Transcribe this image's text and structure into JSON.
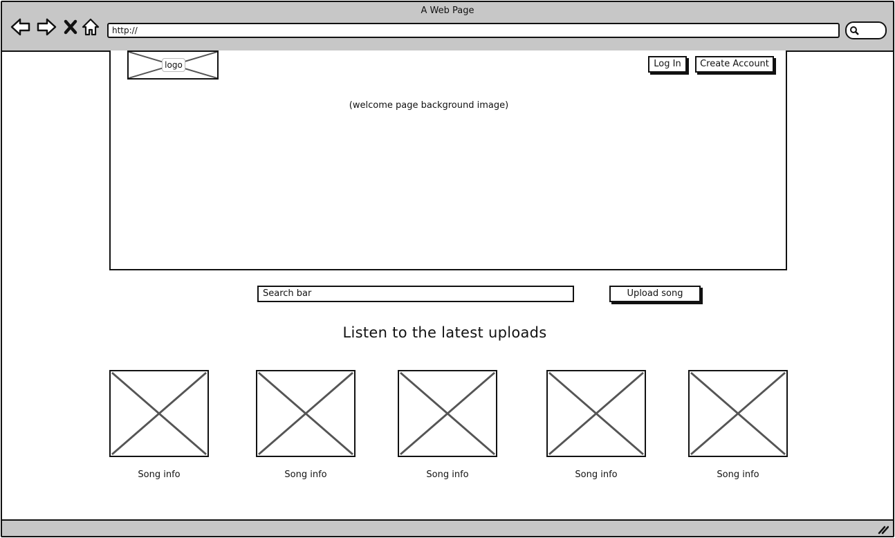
{
  "window": {
    "title": "A Web Page",
    "url": "http://"
  },
  "toolbar": {
    "icons": [
      "back-arrow-icon",
      "forward-arrow-icon",
      "close-x-icon",
      "home-icon"
    ]
  },
  "hero": {
    "logo_label": "logo",
    "login_label": "Log In",
    "create_account_label": "Create Account",
    "caption": "(welcome page background image)"
  },
  "search": {
    "placeholder": "Search bar"
  },
  "upload": {
    "label": "Upload song"
  },
  "section": {
    "title": "Listen to the latest uploads"
  },
  "songs": [
    {
      "info": "Song info"
    },
    {
      "info": "Song info"
    },
    {
      "info": "Song info"
    },
    {
      "info": "Song info"
    },
    {
      "info": "Song info"
    }
  ],
  "colors": {
    "chrome": "#c7c7c7",
    "stroke": "#111111",
    "placeholder_x": "#555555"
  }
}
